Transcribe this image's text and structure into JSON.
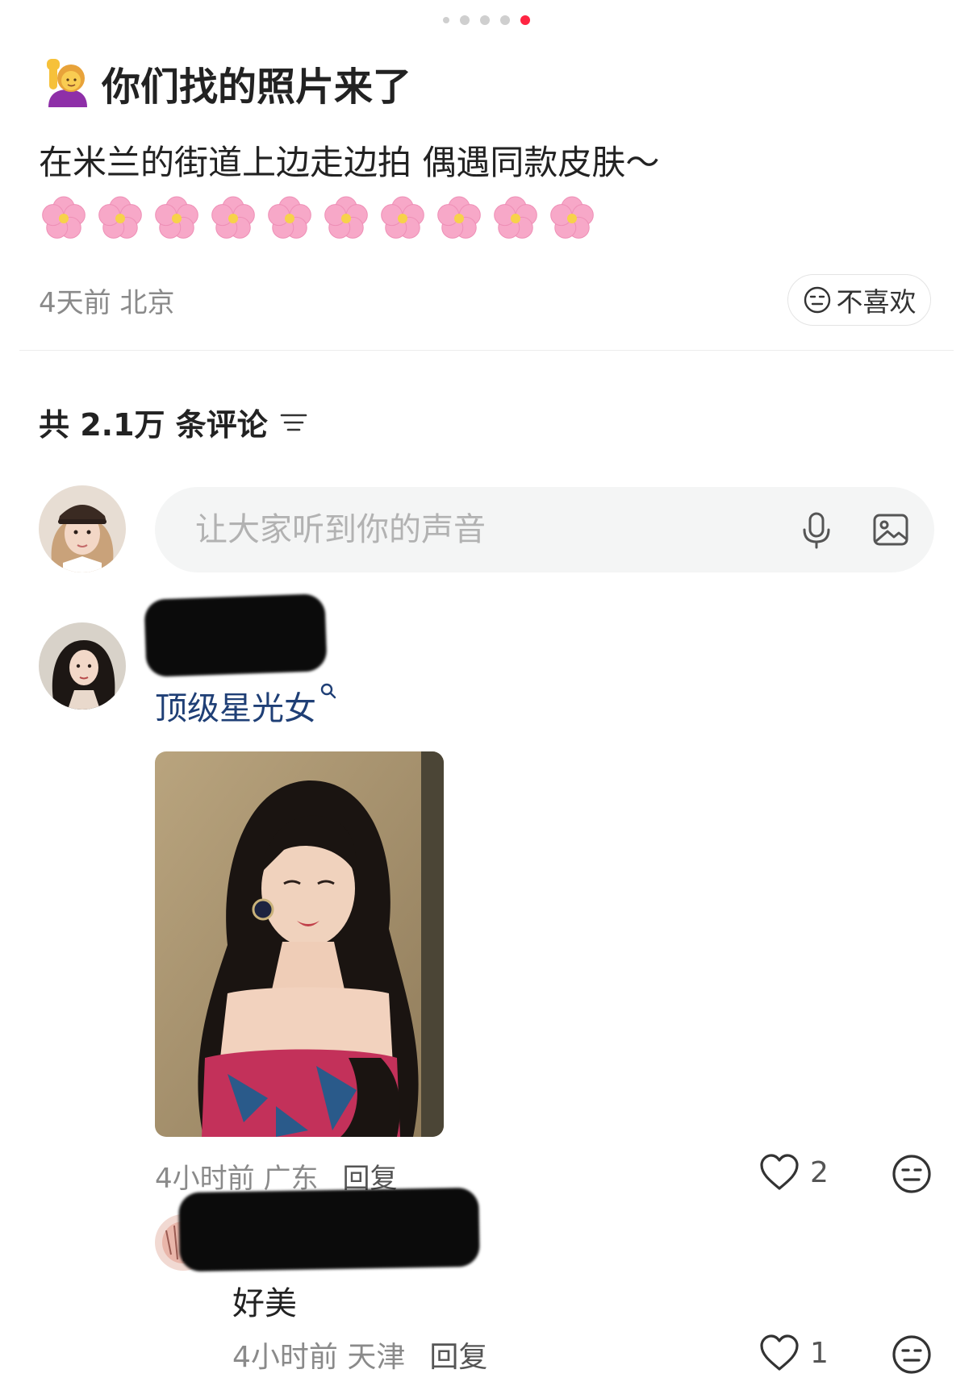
{
  "carousel": {
    "count": 5,
    "active_index": 4
  },
  "post": {
    "title": "你们找的照片来了",
    "title_emoji": "person-raising-hand-icon",
    "body": "在米兰的街道上边走边拍 偶遇同款皮肤～",
    "flower_emoji": "cherry-blossom-icon",
    "flower_count": 10,
    "meta": "4天前 北京",
    "dislike_label": "不喜欢"
  },
  "comments_header": {
    "label": "共 2.1万 条评论"
  },
  "comment_input": {
    "placeholder": "让大家听到你的声音",
    "value": ""
  },
  "comments": [
    {
      "text": "顶级星光女",
      "time": "4小时前 广东",
      "reply_label": "回复",
      "likes": "2"
    },
    {
      "text": "好美",
      "time": "4小时前 天津",
      "reply_label": "回复",
      "likes": "1"
    }
  ],
  "colors": {
    "accent": "#ff2442",
    "link_text": "#1f3f76",
    "muted_text": "#8a8a8a",
    "input_bg": "#f4f5f5"
  }
}
